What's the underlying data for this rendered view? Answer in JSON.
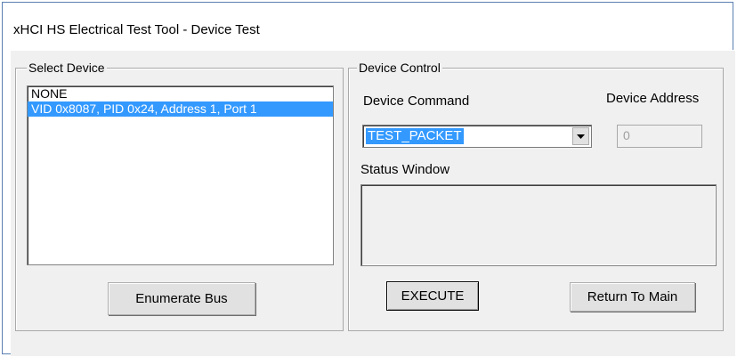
{
  "window": {
    "title": "xHCI HS Electrical Test Tool - Device Test"
  },
  "select_device": {
    "caption": "Select Device",
    "items": [
      {
        "label": "NONE",
        "selected": false
      },
      {
        "label": "VID 0x8087, PID 0x24, Address 1, Port 1",
        "selected": true
      }
    ],
    "enumerate_button": "Enumerate Bus"
  },
  "device_control": {
    "caption": "Device Control",
    "command_label": "Device Command",
    "command_value": "TEST_PACKET",
    "address_label": "Device Address",
    "address_value": "0",
    "status_label": "Status Window",
    "status_text": "",
    "execute_button": "EXECUTE",
    "return_button": "Return To Main"
  },
  "icons": {
    "dropdown": "chevron-down-icon"
  },
  "colors": {
    "selection": "#3399ff",
    "dialog_bg": "#f0f0f0",
    "window_border": "#5a7fb0"
  }
}
